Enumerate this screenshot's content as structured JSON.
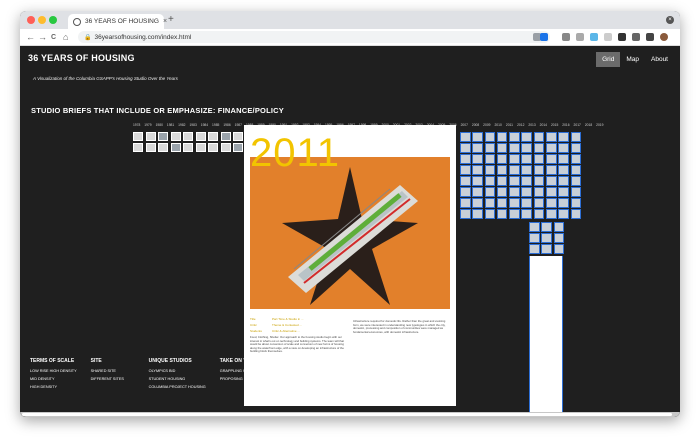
{
  "browser": {
    "tab_title": "36 YEARS OF HOUSING",
    "tab_close": "×",
    "new_tab": "+",
    "url": "36yearsofhousing.com/index.html",
    "back": "←",
    "forward": "→",
    "reload": "C",
    "home": "⌂",
    "lock": "🔒",
    "window_close": "×"
  },
  "site": {
    "title": "36 YEARS OF HOUSING",
    "subtitle": "A Visualization of the Columbia GSAPP's Housing Studio Over the Years",
    "nav": [
      {
        "label": "Grid",
        "active": true
      },
      {
        "label": "Map",
        "active": false
      },
      {
        "label": "About",
        "active": false
      }
    ]
  },
  "section_heading": "STUDIO BRIEFS THAT INCLUDE OR EMPHASIZE: FINANCE/POLICY",
  "years": [
    "1978",
    "1979",
    "1980",
    "1981",
    "1982",
    "1983",
    "1984",
    "1985",
    "1986",
    "1987",
    "1988",
    "1989",
    "1990",
    "1991",
    "1992",
    "1993",
    "1994",
    "1995",
    "1996",
    "1997",
    "1998",
    "1999",
    "2000",
    "2001",
    "2002",
    "2003",
    "2004",
    "2005",
    "2006",
    "2007",
    "2008",
    "2009",
    "2010",
    "2011",
    "2012",
    "2013",
    "2014",
    "2015",
    "2016",
    "2017",
    "2018",
    "2019"
  ],
  "filters": [
    {
      "heading": "TERMS OF SCALE",
      "items": [
        "LOW RISE HIGH DENSITY",
        "MID DENSITY",
        "HIGH DENSITY"
      ]
    },
    {
      "heading": "SITE",
      "items": [
        "SHARED SITE",
        "DIFFERENT SITES"
      ]
    },
    {
      "heading": "UNIQUE STUDIOS",
      "items": [
        "OLYMPICS BID",
        "STUDENT HOUSING",
        "COLUMBIA PROJECT HOUSING"
      ]
    },
    {
      "heading": "TAKE ON \"HOUSING PROBLE",
      "items": [
        "GRAPPLING WITH GENERIC",
        "PROPOSING NEW MODES"
      ]
    }
  ],
  "detail": {
    "year": "2011",
    "meta": [
      {
        "key": "Title",
        "value": "Part Time & Studio in ..."
      },
      {
        "key": "Critic",
        "value": "Theme & Contested ..."
      },
      {
        "key": "Students",
        "value": "Critic & Alternative ..."
      }
    ],
    "body_left": "Food, Clothing, Shelter. Our approach to the housing studio begin with our interest in what's out on technology and building systems. The team will that would be about conversion of scale and conversion of new forms of housing along the waterfront edge, with a view on developing an infrastructure of the building block themselves.",
    "body_right": "Infrastructure required for domestic life. Rather than the great and evolving form, we were interested in understanding new typologies in which the city, domestic, processing and composition of communities were managed as fundamental economies, with domestic infrastructure."
  },
  "colors": {
    "page_bg": "#1f1f1f",
    "accent_year": "#f2c400",
    "selected_border": "#2d6fd6",
    "nav_active": "#6b6b6b"
  }
}
